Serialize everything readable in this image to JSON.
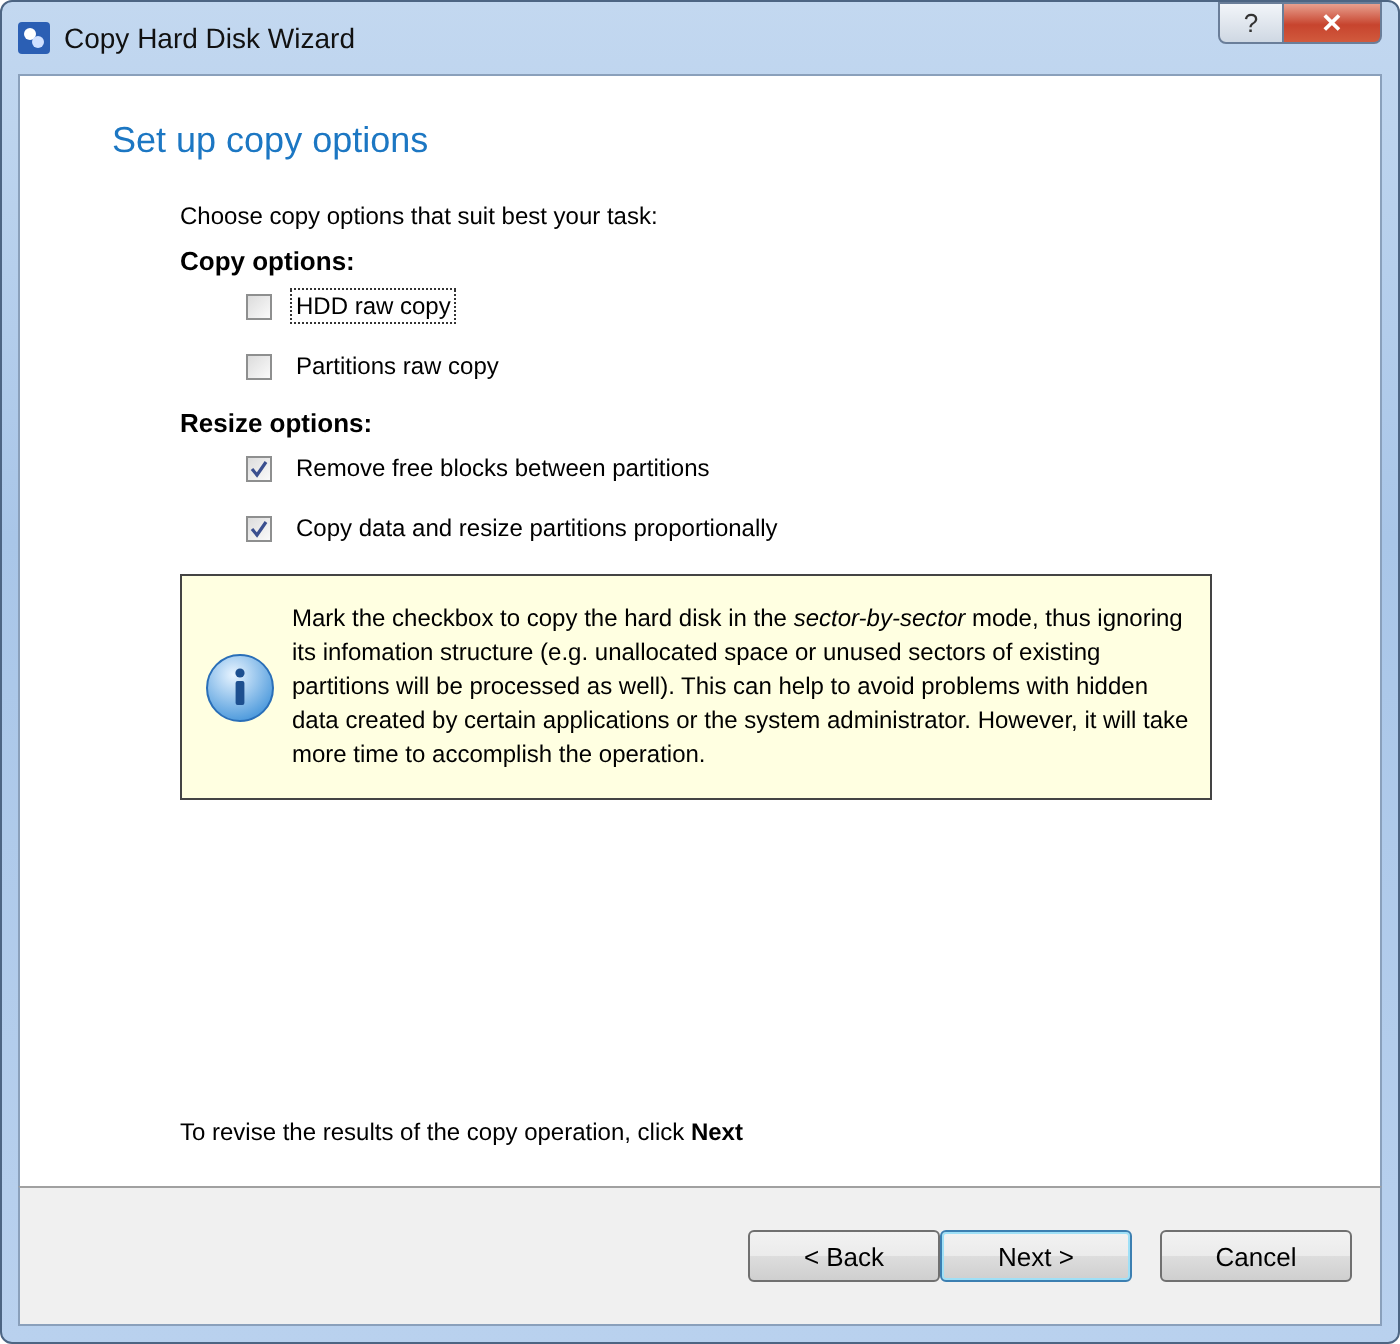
{
  "window": {
    "title": "Copy Hard Disk Wizard",
    "buttons": [
      {
        "kind": "help",
        "label": "?"
      },
      {
        "kind": "close",
        "label": "✕"
      }
    ]
  },
  "heading": "Set up copy options",
  "intro": "Choose copy options that suit best your task:",
  "sections": [
    {
      "title": "Copy options:",
      "options": [
        {
          "label": "HDD raw copy",
          "checked": false,
          "focused": true
        },
        {
          "label": "Partitions raw copy",
          "checked": false,
          "focused": false
        }
      ]
    },
    {
      "title": "Resize options:",
      "options": [
        {
          "label": "Remove free blocks between partitions",
          "checked": true,
          "focused": false
        },
        {
          "label": "Copy data and resize partitions proportionally",
          "checked": true,
          "focused": false
        }
      ]
    }
  ],
  "note": "Mark the checkbox to copy the hard disk in the *sector-by-sector* mode, thus ignoring its infomation structure (e.g. unallocated space or unused sectors of existing partitions will be processed as well). This can help to avoid problems with hidden data created by certain applications or the system administrator. However, it will take more time to accomplish the operation.",
  "footer_hint": "To revise the results of the copy operation, click **Next**",
  "buttons": [
    {
      "label": "< Back",
      "default": false
    },
    {
      "label": "Next >",
      "default": true
    },
    {
      "label": "Cancel",
      "default": false
    }
  ]
}
